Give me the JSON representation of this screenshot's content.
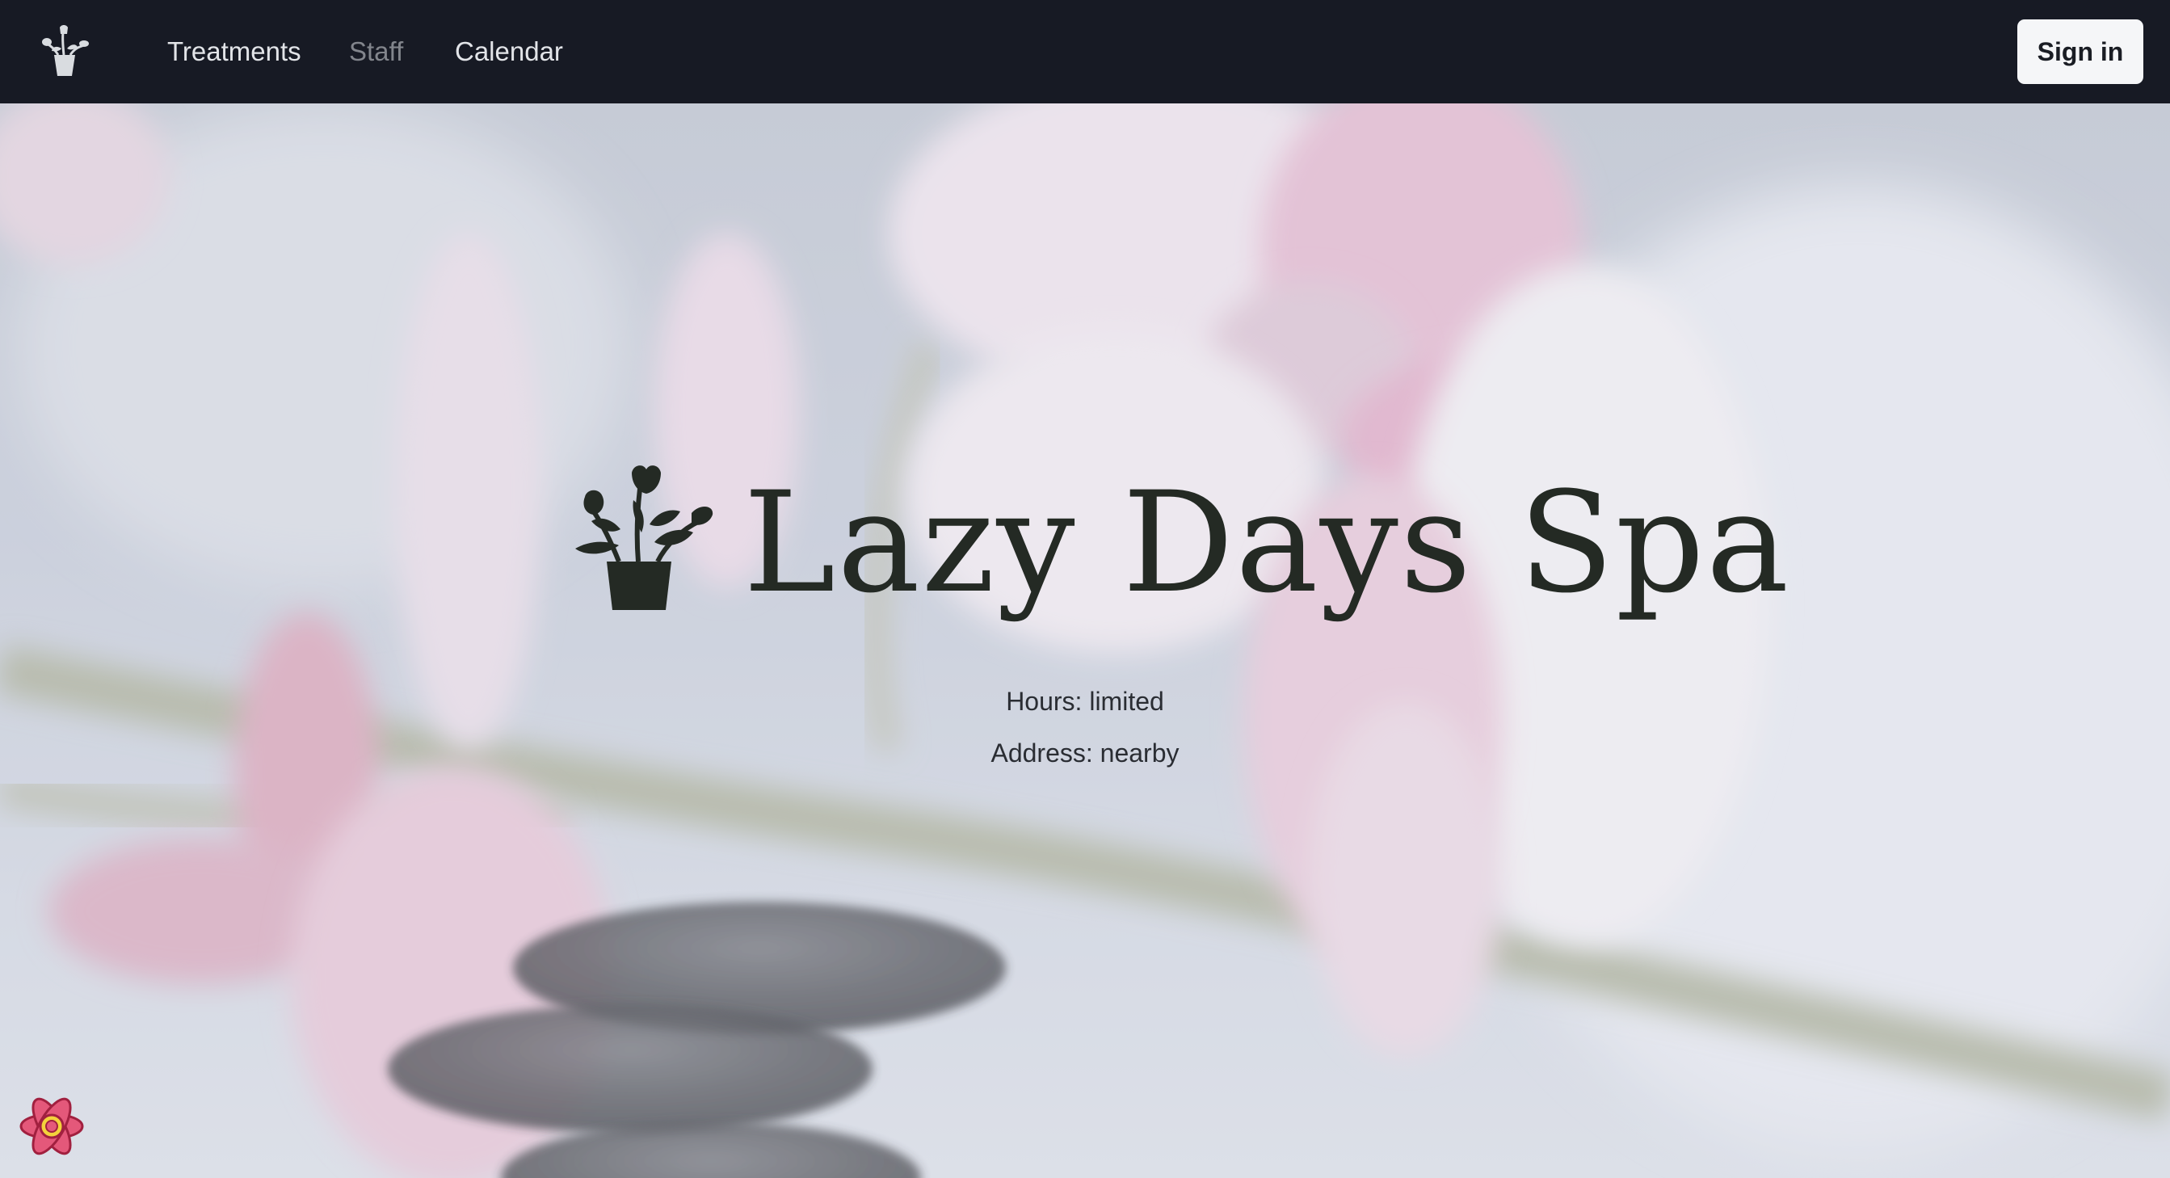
{
  "app": {
    "brand_icon": "potted-plant-icon"
  },
  "nav": {
    "items": [
      {
        "label": "Treatments",
        "state": "normal"
      },
      {
        "label": "Staff",
        "state": "muted"
      },
      {
        "label": "Calendar",
        "state": "normal"
      }
    ],
    "sign_in_label": "Sign in"
  },
  "hero": {
    "icon": "potted-plant-icon",
    "title": "Lazy Days Spa",
    "hours": "Hours: limited",
    "address": "Address: nearby",
    "background": "blurred orchid flowers and stacked spa stones"
  },
  "dev_badge": {
    "icon": "react-query-devtools-icon"
  },
  "colors": {
    "nav_background": "#171a24",
    "nav_text": "#e2e4e8",
    "nav_muted": "#82858c",
    "button_background": "#f5f6f8",
    "title_color": "#242a24",
    "accent_pink": "#e48fb6"
  }
}
